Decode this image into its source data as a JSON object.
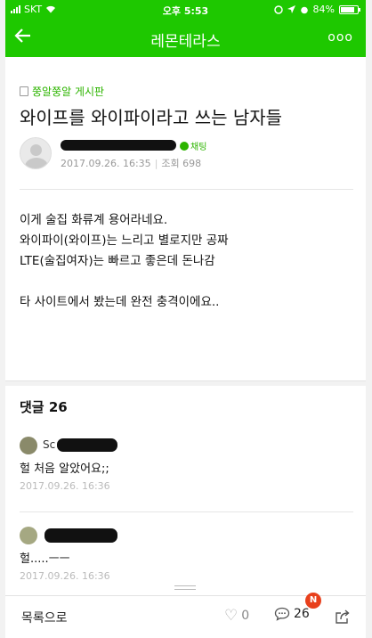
{
  "status_bar": {
    "carrier": "SKT",
    "time": "오후 5:53",
    "battery": "84%",
    "battery_level": 0.84
  },
  "header": {
    "title": "레몬테라스",
    "more": "ooo"
  },
  "post": {
    "board": "쭝알쭝알 게시판",
    "title": "와이프를 와이파이라고 쓰는 남자들",
    "author": {
      "chat_label": "채팅",
      "date": "2017.09.26. 16:35",
      "views": "조회 698"
    },
    "lines": [
      "이게 술집 화류계 용어라네요.",
      "와이파이(와이프)는 느리고 별로지만 공짜",
      "LTE(술집여자)는 빠르고 좋은데 돈나감",
      "",
      "타 사이트에서 봤는데 완전 충격이에요.."
    ]
  },
  "comments": {
    "header": "댓글 26",
    "items": [
      {
        "name_visible": "Sc",
        "text": "헐 처음 알았어요;;",
        "date": "2017.09.26. 16:36"
      },
      {
        "name_visible": "",
        "text": "헐.....ㅡㅡ",
        "date": "2017.09.26. 16:36"
      }
    ]
  },
  "bottom_bar": {
    "list_label": "목록으로",
    "likes": "0",
    "comments": "26",
    "notif_badge": "N"
  },
  "colors": {
    "brand": "#1ec800",
    "accent_text": "#2db400",
    "badge": "#e8401c"
  }
}
